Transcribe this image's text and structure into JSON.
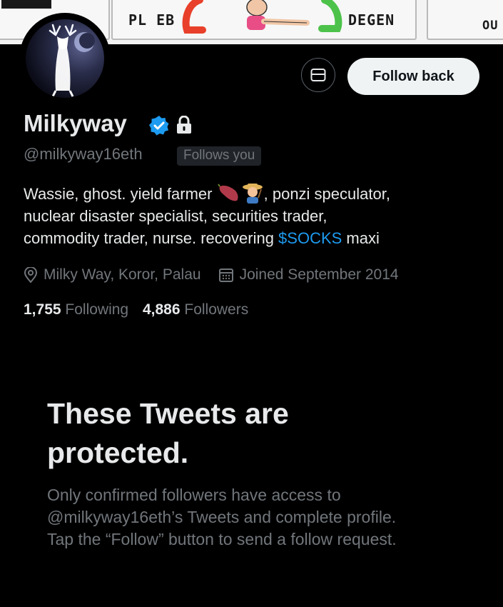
{
  "banner": {
    "labels": [
      "PL EB",
      "DEGEN",
      "OU"
    ]
  },
  "profile": {
    "name": "Milkyway",
    "handle": "@milkyway16eth",
    "follows_you": "Follows you",
    "follow_button": "Follow back",
    "bio": {
      "line1_pre": "Wassie, ghost. yield farmer",
      "line1_post": ", ponzi speculator,",
      "line2": "nuclear disaster specialist, securities trader,",
      "line3_pre": "commodity trader, nurse. recovering ",
      "cashtag": "$SOCKS",
      "line3_post": " maxi"
    },
    "location": "Milky Way, Koror, Palau",
    "joined": "Joined September 2014",
    "following_count": "1,755",
    "following_label": "Following",
    "followers_count": "4,886",
    "followers_label": "Followers"
  },
  "protected": {
    "title_line1": "These Tweets are",
    "title_line2": "protected.",
    "body_line1": "Only confirmed followers have access to",
    "body_line2": "@milkyway16eth’s Tweets and complete profile.",
    "body_line3": "Tap the “Follow” button to send a follow request."
  },
  "icons": {
    "verified": "verified-badge-icon",
    "lock": "lock-icon",
    "message": "envelope-icon",
    "location": "location-pin-icon",
    "calendar": "calendar-icon"
  },
  "colors": {
    "accent": "#1d9bf0",
    "muted": "#71767b",
    "text": "#e7e9ea",
    "background": "#000000"
  }
}
